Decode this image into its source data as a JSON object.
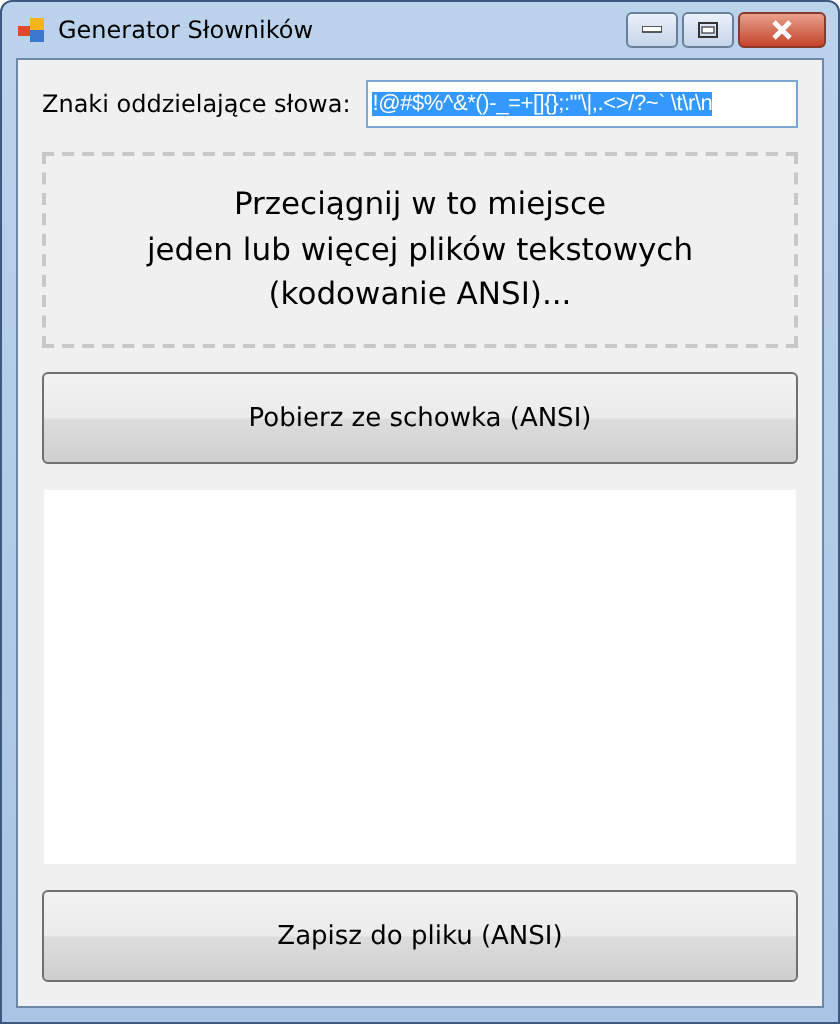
{
  "window": {
    "title": "Generator Słowników"
  },
  "separators": {
    "label": "Znaki oddzielające słowa:",
    "value": "!@#$%^&*()-_=+[]{};:'\"\\|,.<>/?~` \\t\\r\\n",
    "selected": true
  },
  "drop_zone": {
    "text": "Przeciągnij w to miejsce\njeden lub więcej plików tekstowych\n(kodowanie ANSI)..."
  },
  "buttons": [
    {
      "label": "Pobierz ze schowka (ANSI)"
    }
  ],
  "bottom_button": {
    "label": "Zapisz do pliku (ANSI)"
  }
}
